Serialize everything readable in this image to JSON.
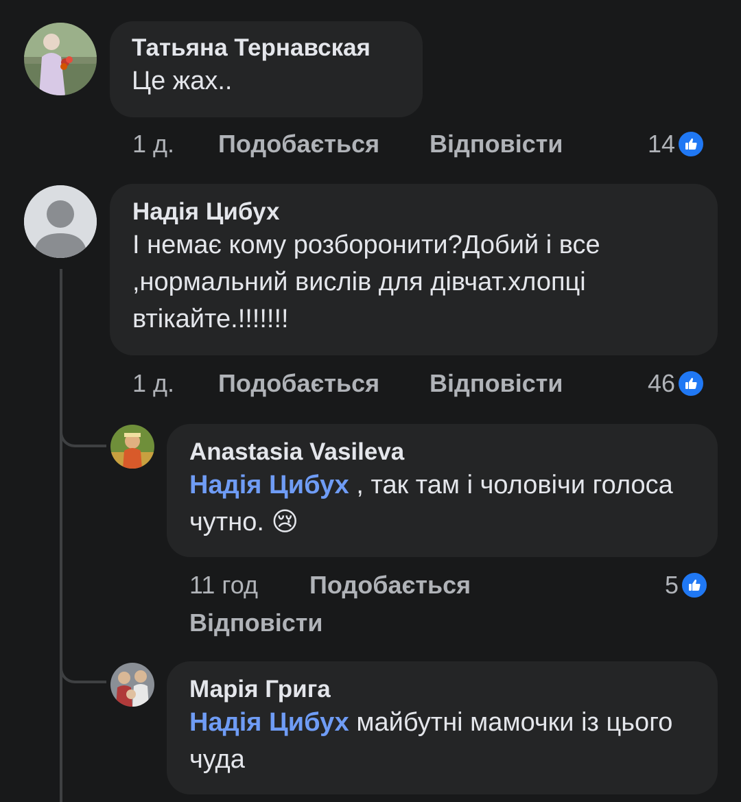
{
  "comments": [
    {
      "author": "Татьяна Тернавская",
      "text": "Це жах..",
      "time": "1 д.",
      "like_label": "Подобається",
      "reply_label": "Відповісти",
      "reactions": "14"
    },
    {
      "author": "Надія Цибух",
      "text": "І немає кому розборонити?Добий і все ,нормальний вислів для дівчат.хлопці втікайте.!!!!!!!",
      "time": "1 д.",
      "like_label": "Подобається",
      "reply_label": "Відповісти",
      "reactions": "46"
    }
  ],
  "replies": [
    {
      "author": "Anastasia Vasileva",
      "mention": "Надія Цибух",
      "text": ", так там і чоловічи голоса чутно.",
      "emoji": "😢",
      "time": "11 год",
      "like_label": "Подобається",
      "reply_label": "Відповісти",
      "reactions": "5"
    },
    {
      "author": "Марія Грига",
      "mention": "Надія Цибух",
      "text": "майбутні мамочки із цього чуда"
    }
  ],
  "icons": {
    "like": "like-thumb-icon",
    "default_avatar": "default-avatar-icon"
  },
  "colors": {
    "background": "#18191a",
    "bubble": "#242526",
    "mention": "#6f9cf5",
    "like_badge": "#2078f4"
  }
}
